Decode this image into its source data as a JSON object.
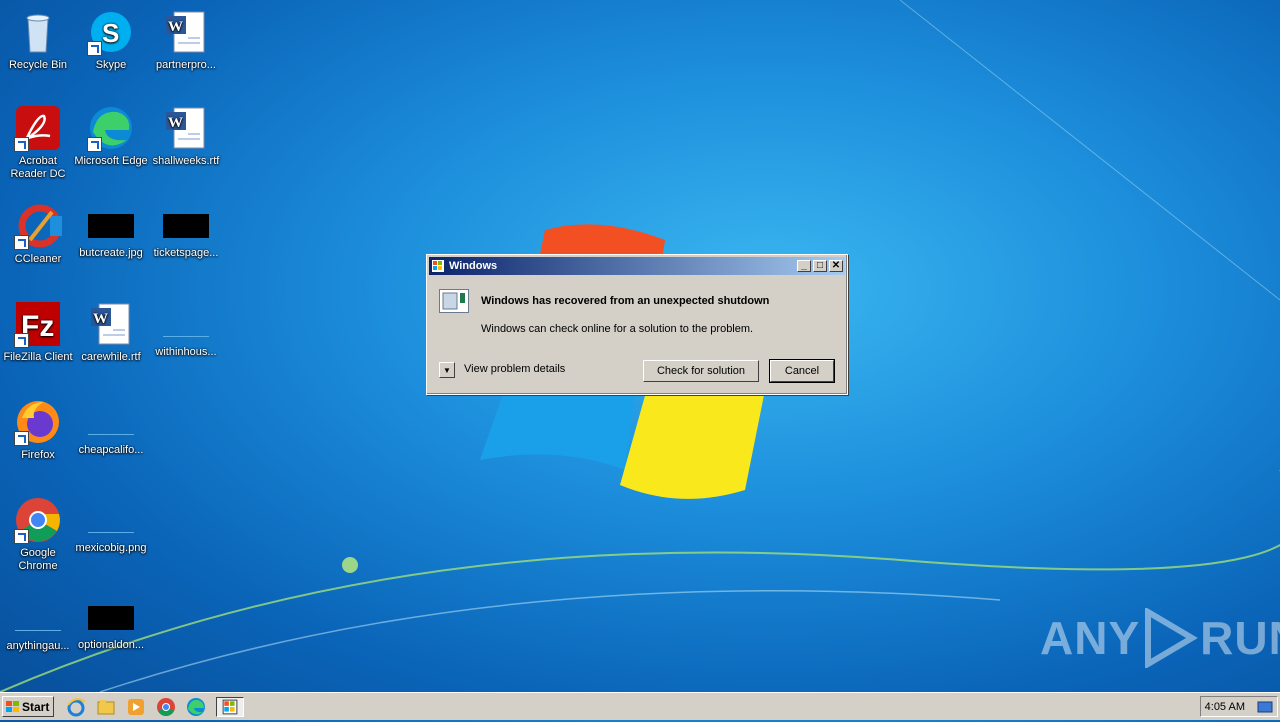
{
  "desktop": {
    "icons": [
      {
        "label": "Recycle Bin",
        "icon": "recycle-bin-icon"
      },
      {
        "label": "Skype",
        "icon": "skype-icon"
      },
      {
        "label": "partnerpro...",
        "icon": "word-document-icon"
      },
      {
        "label": "Acrobat Reader DC",
        "icon": "acrobat-reader-icon"
      },
      {
        "label": "Microsoft Edge",
        "icon": "edge-icon"
      },
      {
        "label": "shallweeks.rtf",
        "icon": "word-document-icon"
      },
      {
        "label": "CCleaner",
        "icon": "ccleaner-icon"
      },
      {
        "label": "butcreate.jpg",
        "icon": "image-file-icon"
      },
      {
        "label": "ticketspage...",
        "icon": "image-file-icon"
      },
      {
        "label": "FileZilla Client",
        "icon": "filezilla-icon"
      },
      {
        "label": "carewhile.rtf",
        "icon": "word-document-icon"
      },
      {
        "label": "withinhous...",
        "icon": "file-icon"
      },
      {
        "label": "Firefox",
        "icon": "firefox-icon"
      },
      {
        "label": "cheapcalifo...",
        "icon": "file-icon"
      },
      {
        "label": "Google Chrome",
        "icon": "chrome-icon"
      },
      {
        "label": "mexicobig.png",
        "icon": "image-file-icon"
      },
      {
        "label": "anythingau...",
        "icon": "file-icon"
      },
      {
        "label": "optionaldon...",
        "icon": "image-file-icon"
      }
    ]
  },
  "dialog": {
    "title": "Windows",
    "heading": "Windows has recovered from an unexpected shutdown",
    "subtext": "Windows can check online for a solution to the problem.",
    "details_label": "View problem details",
    "check_button": "Check for solution",
    "cancel_button": "Cancel",
    "min_glyph": "_",
    "max_glyph": "□",
    "close_glyph": "✕"
  },
  "taskbar": {
    "start_label": "Start",
    "clock": "4:05 AM"
  },
  "watermark": {
    "text_left": "ANY",
    "text_right": "RUN"
  }
}
